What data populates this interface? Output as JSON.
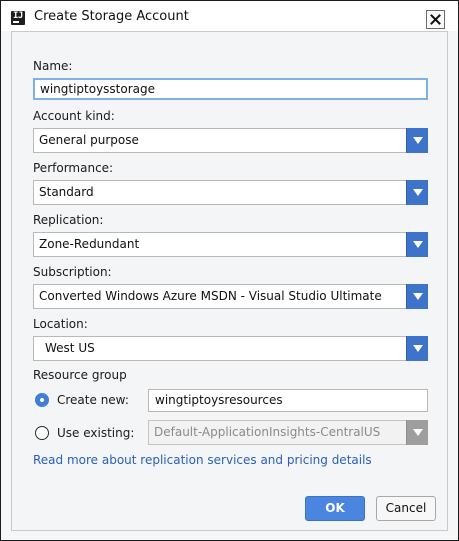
{
  "window": {
    "title": "Create Storage Account",
    "app_icon": "intellij-icon",
    "app_icon_text": "IJ",
    "close_icon": "close-icon"
  },
  "form": {
    "name": {
      "label": "Name:",
      "value": "wingtiptoysstorage"
    },
    "account_kind": {
      "label": "Account kind:",
      "selected": "General purpose"
    },
    "performance": {
      "label": "Performance:",
      "selected": "Standard"
    },
    "replication": {
      "label": "Replication:",
      "selected": "Zone-Redundant"
    },
    "subscription": {
      "label": "Subscription:",
      "selected": "Converted Windows Azure MSDN - Visual Studio Ultimate"
    },
    "location": {
      "label": "Location:",
      "selected": "West US"
    },
    "resource_group": {
      "label": "Resource group",
      "create_new": {
        "label": "Create new:",
        "checked": true,
        "value": "wingtiptoysresources"
      },
      "use_existing": {
        "label": "Use existing:",
        "checked": false,
        "selected": "Default-ApplicationInsights-CentralUS"
      }
    }
  },
  "link": {
    "text": "Read more about replication services and pricing details"
  },
  "buttons": {
    "ok": "OK",
    "cancel": "Cancel"
  },
  "colors": {
    "accent": "#3d73c9",
    "primary_button": "#4a86e0",
    "link": "#2a5fbb",
    "focus_border": "#7fb0e8"
  }
}
